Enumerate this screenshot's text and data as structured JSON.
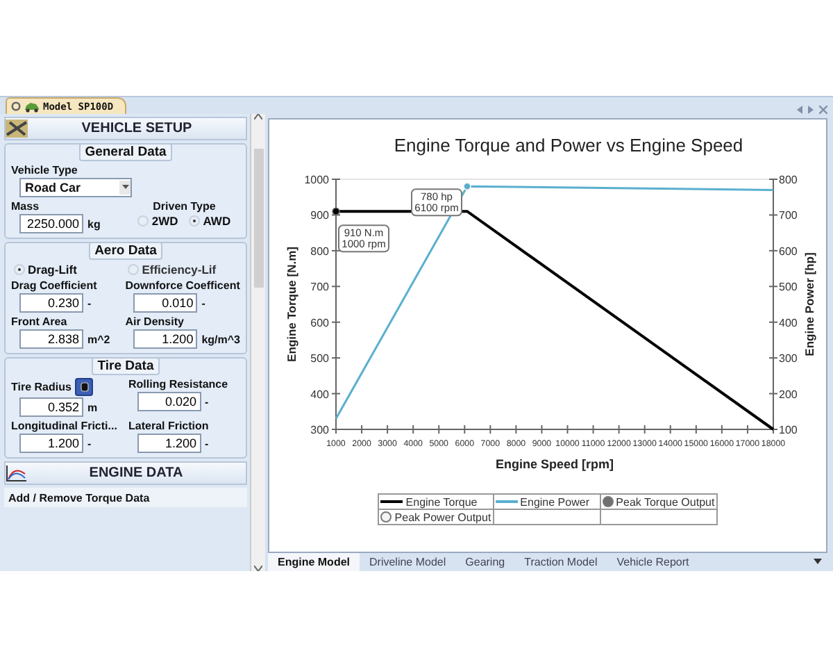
{
  "document_tab": {
    "title": "Model SP100D"
  },
  "setup_panel": {
    "title": "VEHICLE SETUP",
    "groups": [
      {
        "title": "General Data",
        "fields": [
          {
            "kind": "select",
            "label": "Vehicle Type",
            "value": "Road Car",
            "wide": true
          },
          {
            "kind": "number",
            "label": "Mass",
            "value": "2250.000",
            "unit": "kg"
          },
          {
            "kind": "radios",
            "label": "Driven Type",
            "options": [
              {
                "label": "2WD",
                "selected": false
              },
              {
                "label": "AWD",
                "selected": true
              }
            ]
          }
        ]
      },
      {
        "title": "Aero Data",
        "fields": [
          {
            "kind": "radio",
            "label": "Drag-Lift",
            "selected": true
          },
          {
            "kind": "radio",
            "label": "Efficiency-Lif",
            "selected": false
          },
          {
            "kind": "number",
            "label": "Drag Coefficient",
            "value": "0.230",
            "unit": "-"
          },
          {
            "kind": "number",
            "label": "Downforce Coefficent",
            "value": "0.010",
            "unit": "-"
          },
          {
            "kind": "number",
            "label": "Front Area",
            "value": "2.838",
            "unit": "m^2"
          },
          {
            "kind": "number",
            "label": "Air Density",
            "value": "1.200",
            "unit": "kg/m^3"
          }
        ]
      },
      {
        "title": "Tire Data",
        "fields": [
          {
            "kind": "number",
            "label": "Tire Radius",
            "value": "0.352",
            "unit": "m",
            "tool": true
          },
          {
            "kind": "number",
            "label": "Rolling Resistance",
            "value": "0.020",
            "unit": "-"
          },
          {
            "kind": "number",
            "label": "Longitudinal Fricti...",
            "value": "1.200",
            "unit": "-"
          },
          {
            "kind": "number",
            "label": "Lateral Friction",
            "value": "1.200",
            "unit": "-"
          }
        ]
      }
    ],
    "engine_section": {
      "title": "ENGINE DATA",
      "item": "Add / Remove Torque Data"
    }
  },
  "chart_panel": {
    "chart_data": {
      "type": "line",
      "title": "Engine Torque and Power vs Engine Speed",
      "xlabel": "Engine Speed [rpm]",
      "ylabel": "Engine Torque [N.m]",
      "y2label": "Engine Power [hp]",
      "x": [
        1000,
        6100,
        18000
      ],
      "series": [
        {
          "name": "Engine Torque",
          "color": "#000000",
          "values": [
            910,
            910,
            300
          ]
        },
        {
          "name": "Engine Power",
          "color": "#5aafcf",
          "axis": "y2",
          "values": [
            130,
            780,
            770
          ]
        }
      ],
      "xlim": [
        1000,
        18000
      ],
      "ylim": [
        300,
        1000
      ],
      "y2lim": [
        100,
        800
      ],
      "xticks": [
        1000,
        2000,
        3000,
        4000,
        5000,
        6000,
        7000,
        8000,
        9000,
        10000,
        11000,
        12000,
        13000,
        14000,
        15000,
        16000,
        17000,
        18000
      ],
      "yticks": [
        300,
        400,
        500,
        600,
        700,
        800,
        900,
        1000
      ],
      "y2ticks": [
        100,
        200,
        300,
        400,
        500,
        600,
        700,
        800
      ],
      "annotations": [
        "910 N.m\n1000 rpm",
        "780 hp\n6100 rpm"
      ]
    },
    "legend_markers": [
      {
        "label": "Peak Torque Output",
        "color": "#707070"
      },
      {
        "label": "Peak Power Output",
        "color": "#f4f4f4"
      }
    ]
  },
  "bottom_tabs": [
    {
      "label": "Engine Model",
      "selected": true
    },
    {
      "label": "Driveline Model",
      "selected": false
    },
    {
      "label": "Gearing",
      "selected": false
    },
    {
      "label": "Traction Model",
      "selected": false
    },
    {
      "label": "Vehicle Report",
      "selected": false
    }
  ]
}
